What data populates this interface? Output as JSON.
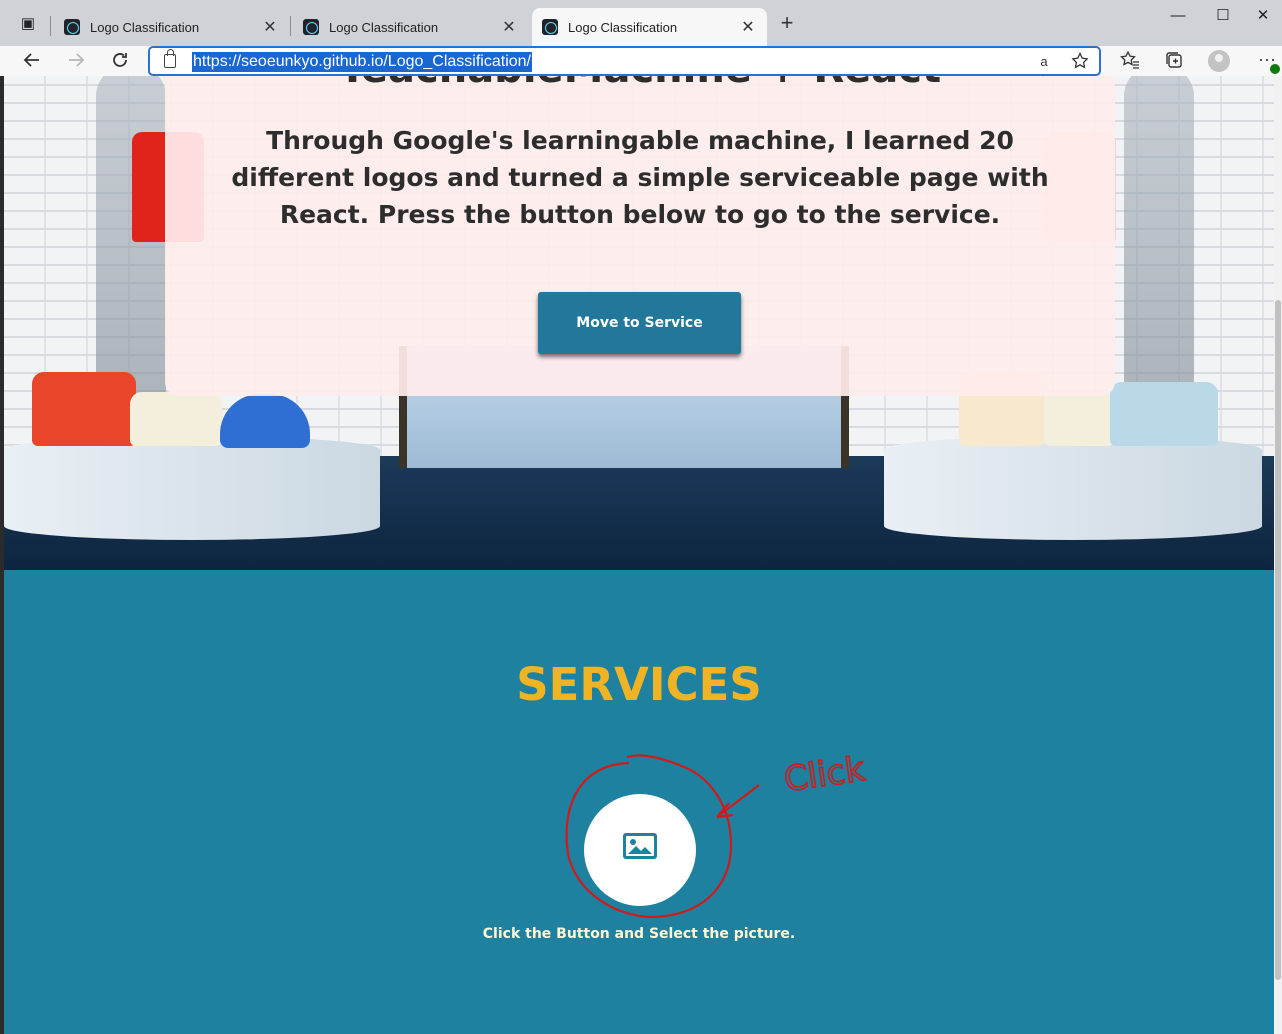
{
  "browser": {
    "tabs": [
      {
        "title": "Logo Classification",
        "active": false
      },
      {
        "title": "Logo Classification",
        "active": false
      },
      {
        "title": "Logo Classification",
        "active": true
      }
    ],
    "url": "https://seoeunkyo.github.io/Logo_Classification/",
    "icons": {
      "back": "back-arrow-icon",
      "forward": "forward-arrow-icon",
      "reload": "reload-icon",
      "read_aloud": "read-aloud-icon",
      "add_favorite": "add-favorite-icon",
      "favorites": "favorites-icon",
      "collections": "collections-icon",
      "profile": "profile-icon",
      "more": "more-icon"
    },
    "read_aloud_glyph": "aあ"
  },
  "hero": {
    "title": "TeachableMachine + React",
    "description": "Through Google's learningable machine, I learned 20 different logos and turned a simple serviceable page with React. Press the button below to go to the service.",
    "button_label": "Move to Service"
  },
  "services": {
    "title": "SERVICES",
    "upload_icon": "image-icon",
    "caption": "Click the Button and Select the picture.",
    "annotation_text": "Click"
  },
  "colors": {
    "services_bg": "#1d819f",
    "services_title": "#f0b323",
    "button_bg": "#22789a",
    "annotation": "#d11a1a"
  }
}
